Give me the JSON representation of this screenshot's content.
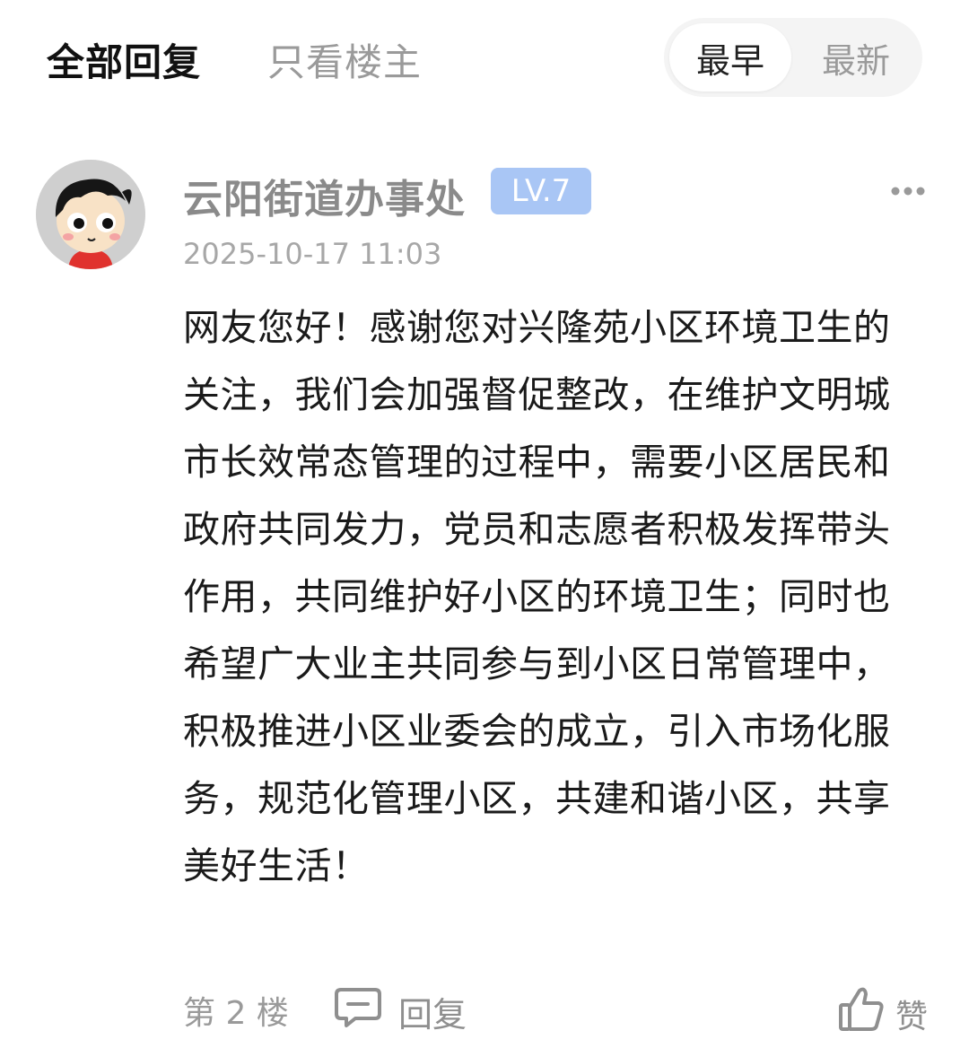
{
  "tabs": {
    "all_replies": "全部回复",
    "op_only": "只看楼主"
  },
  "sort": {
    "earliest": "最早",
    "latest": "最新"
  },
  "post": {
    "author": "云阳街道办事处",
    "level": "LV.7",
    "time": "2025-10-17 11:03",
    "body": "网友您好！感谢您对兴隆苑小区环境卫生的关注，我们会加强督促整改，在维护文明城市长效常态管理的过程中，需要小区居民和政府共同发力，党员和志愿者积极发挥带头作用，共同维护好小区的环境卫生；同时也希望广大业主共同参与到小区日常管理中，积极推进小区业委会的成立，引入市场化服务，规范化管理小区，共建和谐小区，共享美好生活！",
    "floor": "第 2 楼",
    "reply_label": "回复",
    "like_label": "赞"
  },
  "icons": {
    "more": "more-dots-icon",
    "reply": "comment-bubble-icon",
    "like": "thumbs-up-icon"
  },
  "colors": {
    "badge_bg": "#a9c6f5",
    "muted_text": "#9a9a9a",
    "toggle_bg": "#f4f4f4"
  }
}
